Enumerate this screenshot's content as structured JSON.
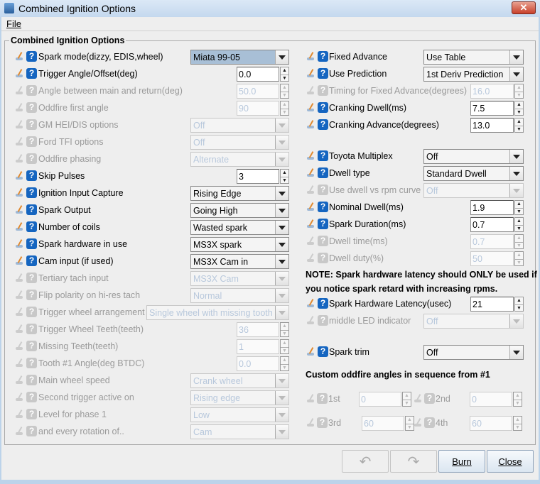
{
  "window": {
    "title": "Combined Ignition Options",
    "close": "✕"
  },
  "menu": {
    "file": "File"
  },
  "group_title": "Combined Ignition Options",
  "left_rows": [
    {
      "label": "Spark mode(dizzy, EDIS,wheel)",
      "type": "combo",
      "value": "Miata 99-05",
      "enabled": true,
      "selected": true
    },
    {
      "label": "Trigger Angle/Offset(deg)",
      "type": "spin",
      "value": "0.0",
      "enabled": true
    },
    {
      "label": "Angle between main and return(deg)",
      "type": "spin",
      "value": "50.0",
      "enabled": false
    },
    {
      "label": "Oddfire first angle",
      "type": "spin",
      "value": "90",
      "enabled": false
    },
    {
      "label": "GM HEI/DIS options",
      "type": "combo",
      "value": "Off",
      "enabled": false
    },
    {
      "label": "Ford TFI options",
      "type": "combo",
      "value": "Off",
      "enabled": false
    },
    {
      "label": "Oddfire phasing",
      "type": "combo",
      "value": "Alternate",
      "enabled": false
    },
    {
      "label": "Skip Pulses",
      "type": "spin",
      "value": "3",
      "enabled": true
    },
    {
      "label": "Ignition Input Capture",
      "type": "combo",
      "value": "Rising Edge",
      "enabled": true
    },
    {
      "label": "Spark Output",
      "type": "combo",
      "value": "Going High",
      "enabled": true
    },
    {
      "label": "Number of coils",
      "type": "combo",
      "value": "Wasted spark",
      "enabled": true
    },
    {
      "label": "Spark hardware in use",
      "type": "combo",
      "value": "MS3X spark",
      "enabled": true
    },
    {
      "label": "Cam input (if used)",
      "type": "combo",
      "value": "MS3X Cam in",
      "enabled": true
    },
    {
      "label": "Tertiary tach input",
      "type": "combo",
      "value": "MS3X Cam",
      "enabled": false
    },
    {
      "label": "Flip polarity on hi-res tach",
      "type": "combo",
      "value": "Normal",
      "enabled": false
    },
    {
      "label": "Trigger wheel arrangement",
      "type": "widecombo",
      "value": "Single wheel with missing tooth",
      "enabled": false
    },
    {
      "label": "Trigger Wheel Teeth(teeth)",
      "type": "spin",
      "value": "36",
      "enabled": false
    },
    {
      "label": "Missing Teeth(teeth)",
      "type": "spin",
      "value": "1",
      "enabled": false
    },
    {
      "label": "Tooth #1 Angle(deg BTDC)",
      "type": "spin",
      "value": "0.0",
      "enabled": false
    },
    {
      "label": "Main wheel speed",
      "type": "combo",
      "value": "Crank wheel",
      "enabled": false
    },
    {
      "label": "Second trigger active on",
      "type": "combo",
      "value": "Rising edge",
      "enabled": false
    },
    {
      "label": "Level for phase 1",
      "type": "combo",
      "value": "Low",
      "enabled": false
    },
    {
      "label": "and every rotation of..",
      "type": "combo",
      "value": "Cam",
      "enabled": false
    }
  ],
  "right_rows": [
    {
      "label": "Fixed Advance",
      "type": "combo",
      "value": "Use Table",
      "enabled": true
    },
    {
      "label": "Use Prediction",
      "type": "combo",
      "value": "1st Deriv Prediction",
      "enabled": true
    },
    {
      "label": "Timing for Fixed Advance(degrees)",
      "type": "spin",
      "value": "16.0",
      "enabled": false
    },
    {
      "label": "Cranking Dwell(ms)",
      "type": "spin",
      "value": "7.5",
      "enabled": true
    },
    {
      "label": "Cranking Advance(degrees)",
      "type": "spin",
      "value": "13.0",
      "enabled": true
    },
    {
      "label": "Toyota Multiplex",
      "type": "combo",
      "value": "Off",
      "enabled": true
    },
    {
      "label": "Dwell type",
      "type": "combo",
      "value": "Standard Dwell",
      "enabled": true
    },
    {
      "label": "Use dwell vs rpm curve",
      "type": "combo",
      "value": "Off",
      "enabled": false
    },
    {
      "label": "Nominal Dwell(ms)",
      "type": "spin",
      "value": "1.9",
      "enabled": true
    },
    {
      "label": "Spark Duration(ms)",
      "type": "spin",
      "value": "0.7",
      "enabled": true
    },
    {
      "label": "Dwell time(ms)",
      "type": "spin",
      "value": "0.7",
      "enabled": false
    },
    {
      "label": "Dwell duty(%)",
      "type": "spin",
      "value": "50",
      "enabled": false
    },
    {
      "label": "Spark Hardware Latency(usec)",
      "type": "spin",
      "value": "21",
      "enabled": true
    },
    {
      "label": "middle LED indicator",
      "type": "combo",
      "value": "Off",
      "enabled": false
    },
    {
      "label": "Spark trim",
      "type": "combo",
      "value": "Off",
      "enabled": true
    }
  ],
  "note_lines": [
    "NOTE: Spark hardware latency should ONLY be used if",
    "you notice spark retard with increasing rpms."
  ],
  "oddfire_heading": "Custom oddfire angles in sequence from #1",
  "oddfire": [
    {
      "label": "1st",
      "value": "0"
    },
    {
      "label": "2nd",
      "value": "0"
    },
    {
      "label": "3rd",
      "value": "60"
    },
    {
      "label": "4th",
      "value": "60"
    }
  ],
  "buttons": {
    "undo": "↶",
    "redo": "↷",
    "burn": "Burn",
    "close": "Close"
  }
}
